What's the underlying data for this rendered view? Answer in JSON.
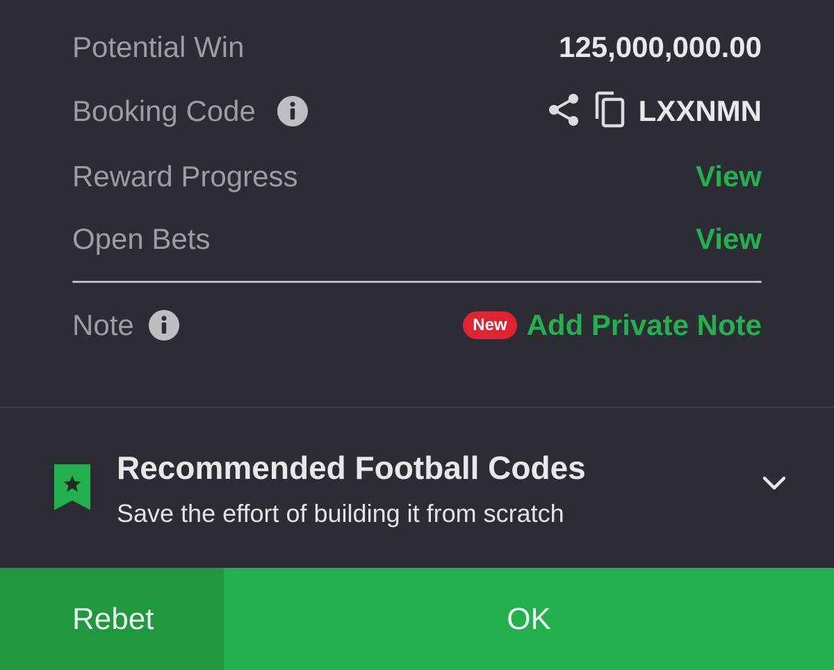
{
  "summary": {
    "potential_win_label": "Potential Win",
    "potential_win_value": "125,000,000.00",
    "booking_code_label": "Booking Code",
    "booking_code_value": "LXXNMN",
    "reward_progress_label": "Reward Progress",
    "reward_progress_action": "View",
    "open_bets_label": "Open Bets",
    "open_bets_action": "View"
  },
  "note": {
    "label": "Note",
    "badge": "New",
    "action": "Add Private Note"
  },
  "recommended": {
    "title": "Recommended Football Codes",
    "subtitle": "Save the effort of building it from scratch"
  },
  "footer": {
    "rebet_label": "Rebet",
    "ok_label": "OK"
  },
  "icons": {
    "info": "info-icon",
    "share": "share-icon",
    "copy": "copy-icon",
    "bookmark": "bookmark-star-icon",
    "chevron": "chevron-down-icon"
  },
  "colors": {
    "background": "#2b2c34",
    "accent_green": "#22b14c",
    "rebet_green": "#1f983f",
    "badge_red": "#e0242f"
  }
}
